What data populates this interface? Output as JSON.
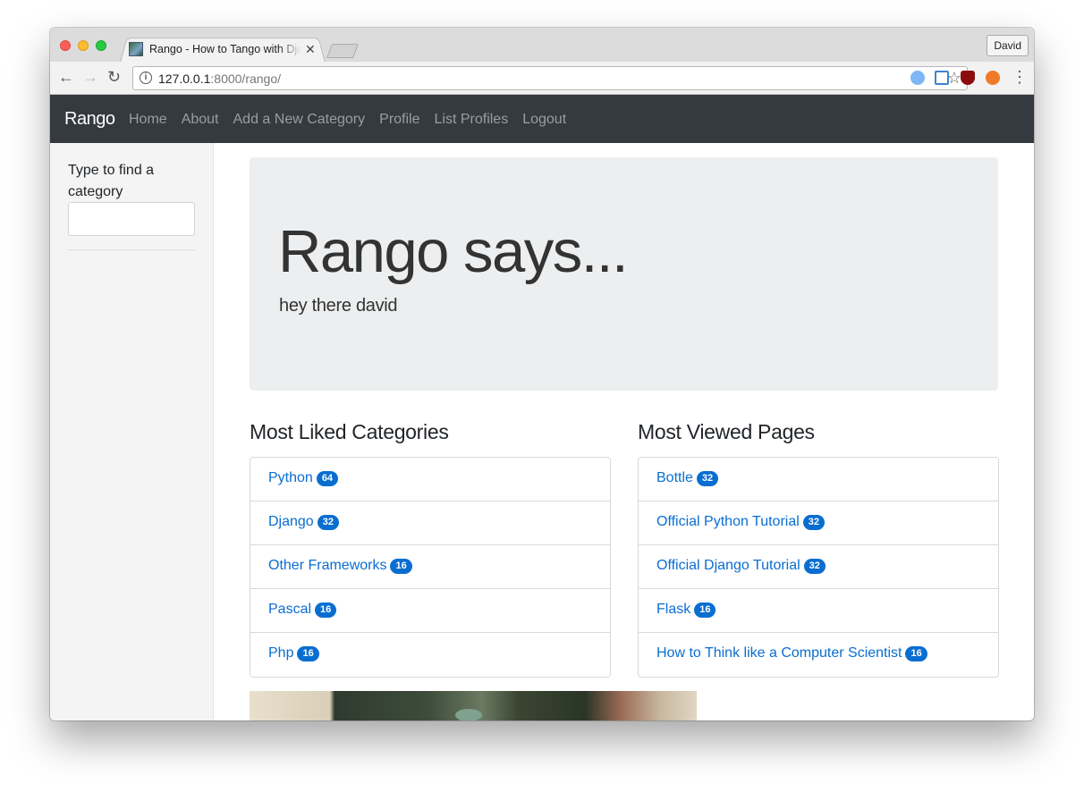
{
  "browser": {
    "tab_title": "Rango - How to Tango with Django",
    "url_host": "127.0.0.1",
    "url_path": ":8000/rango/",
    "profile_label": "David"
  },
  "site": {
    "brand": "Rango",
    "nav": [
      "Home",
      "About",
      "Add a New Category",
      "Profile",
      "List Profiles",
      "Logout"
    ]
  },
  "sidebar": {
    "search_label": "Type to find a category",
    "search_value": ""
  },
  "jumbotron": {
    "title": "Rango says...",
    "subtitle": "hey there david"
  },
  "categories": {
    "heading": "Most Liked Categories",
    "items": [
      {
        "name": "Python",
        "count": "64"
      },
      {
        "name": "Django",
        "count": "32"
      },
      {
        "name": "Other Frameworks",
        "count": "16"
      },
      {
        "name": "Pascal",
        "count": "16"
      },
      {
        "name": "Php",
        "count": "16"
      }
    ]
  },
  "pages": {
    "heading": "Most Viewed Pages",
    "items": [
      {
        "name": "Bottle",
        "count": "32"
      },
      {
        "name": "Official Python Tutorial",
        "count": "32"
      },
      {
        "name": "Official Django Tutorial",
        "count": "32"
      },
      {
        "name": "Flask",
        "count": "16"
      },
      {
        "name": "How to Think like a Computer Scientist",
        "count": "16"
      }
    ]
  },
  "colors": {
    "navbar": "#343a40",
    "link": "#0a6ed1",
    "badge": "#0a6ed1",
    "jumbotron": "#eceeef",
    "sidebar": "#f4f4f4"
  }
}
